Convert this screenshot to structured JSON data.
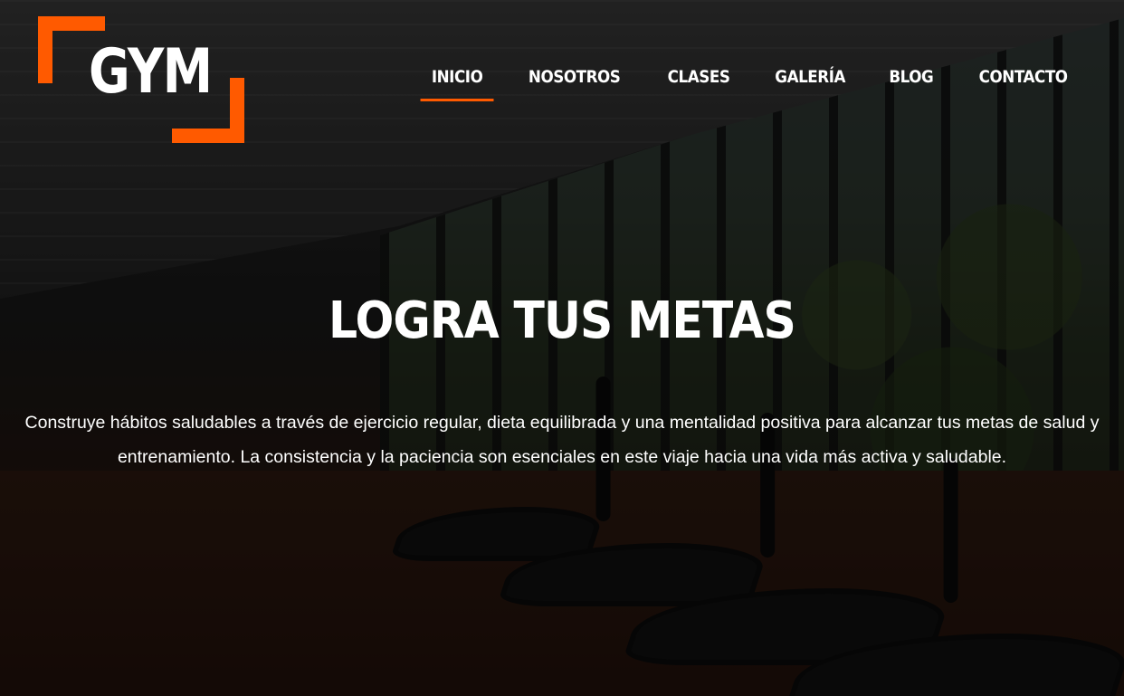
{
  "brand": {
    "logo_text": "GYM",
    "accent_color": "#ff5a00"
  },
  "nav": {
    "items": [
      {
        "label": "INICIO",
        "active": true
      },
      {
        "label": "NOSOTROS",
        "active": false
      },
      {
        "label": "CLASES",
        "active": false
      },
      {
        "label": "GALERÍA",
        "active": false
      },
      {
        "label": "BLOG",
        "active": false
      },
      {
        "label": "CONTACTO",
        "active": false
      }
    ]
  },
  "hero": {
    "headline": "LOGRA TUS METAS",
    "description": "Construye hábitos saludables a través de ejercicio regular, dieta equilibrada y una mentalidad positiva para alcanzar tus metas de salud y entrenamiento. La consistencia y la paciencia son esenciales en este viaje hacia una vida más activa y saludable."
  }
}
